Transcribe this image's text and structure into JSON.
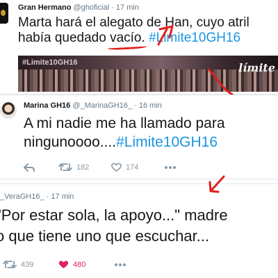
{
  "tweet1": {
    "name": "Gran Hermano",
    "handle": "@ghoficial",
    "time": "17 min",
    "line1": "Marta hará el alegato de Han, cuyo atril",
    "line2_before": "había quedado ",
    "line2_underlined": "vacío.",
    "line2_space": " ",
    "hashtag": "#Limite10GH16",
    "media_tag": "#Limite10GH16",
    "media_logo": "límite"
  },
  "tweet2": {
    "name": "Marina GH16",
    "handle": "@_MarinaGH16_",
    "time": "16 min",
    "text": "A mi nadie me ha llamado para ningunoooo....",
    "hashtag": "#Limite10GH16",
    "retweets": "182",
    "likes": "174"
  },
  "tweet3": {
    "handle": "_VeraGH16_",
    "time": "17 min",
    "line1": "\"Por estar sola, la apoyo...\" madre",
    "line2": "o que tiene uno que escuchar...",
    "retweets": "439",
    "likes": "480"
  },
  "colors": {
    "link": "#1b95e0",
    "like_active": "#e0245e",
    "annotation": "#e0201c",
    "icon_gray": "#8899a6"
  },
  "icons": [
    "reply-icon",
    "retweet-icon",
    "heart-icon",
    "more-icon"
  ]
}
